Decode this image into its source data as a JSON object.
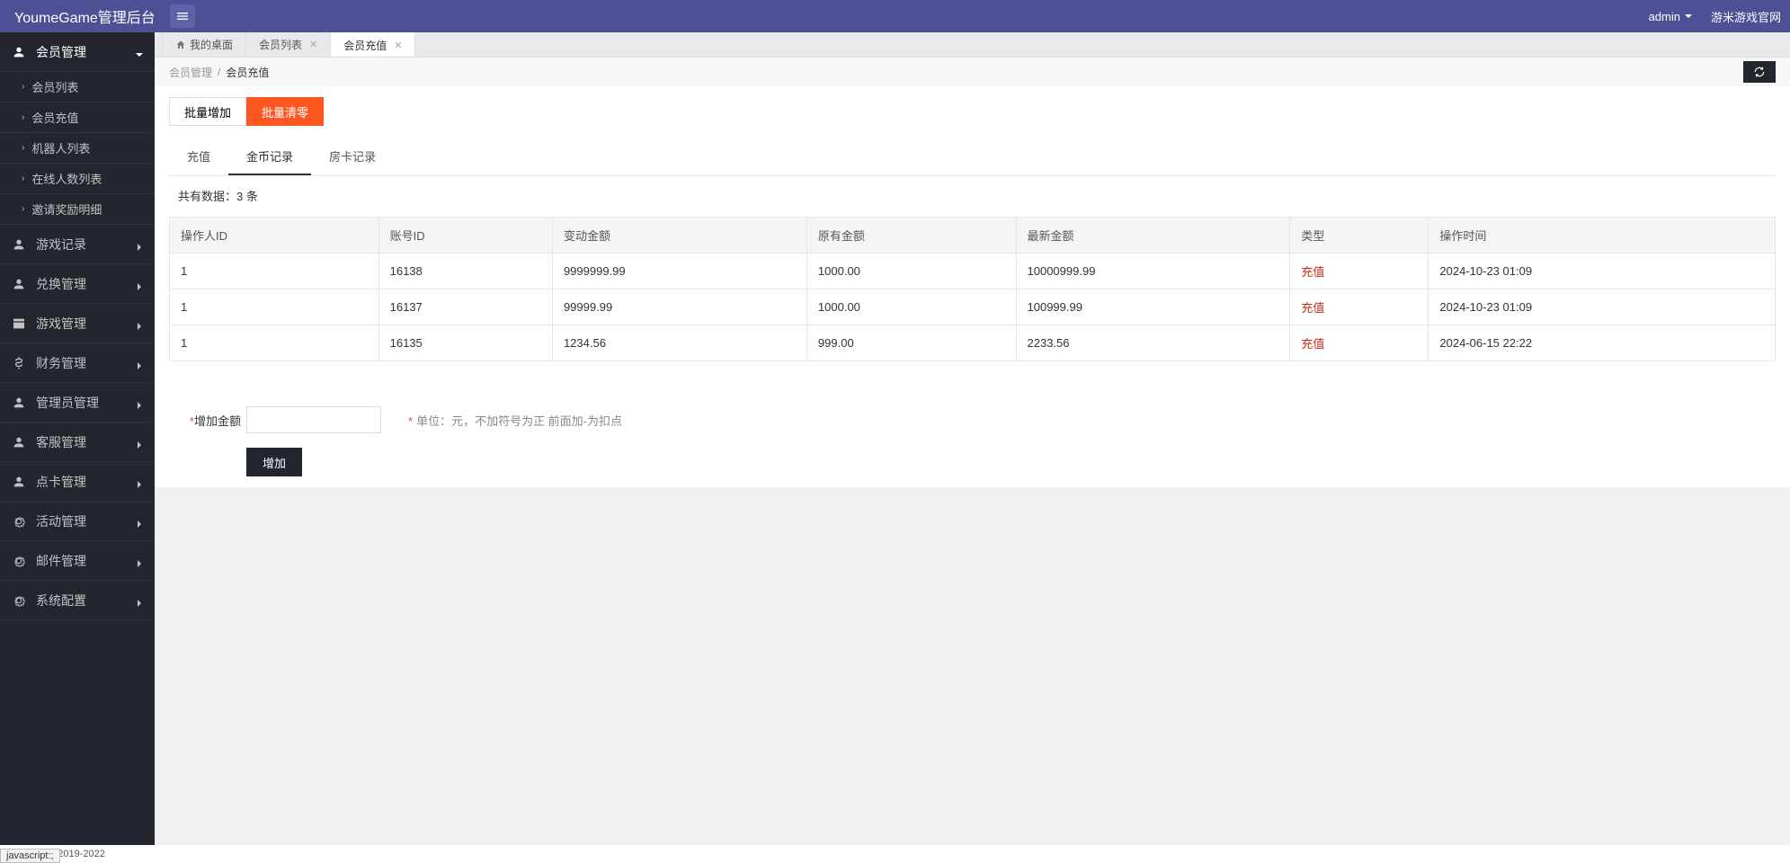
{
  "header": {
    "brand": "YoumeGame管理后台",
    "user": "admin",
    "site_link": "游米游戏官网"
  },
  "sidebar": {
    "items": [
      {
        "label": "会员管理",
        "icon": "user",
        "expanded": true,
        "children": [
          {
            "label": "会员列表"
          },
          {
            "label": "会员充值"
          },
          {
            "label": "机器人列表"
          },
          {
            "label": "在线人数列表"
          },
          {
            "label": "邀请奖励明细"
          }
        ]
      },
      {
        "label": "游戏记录",
        "icon": "user"
      },
      {
        "label": "兑换管理",
        "icon": "user"
      },
      {
        "label": "游戏管理",
        "icon": "browser"
      },
      {
        "label": "财务管理",
        "icon": "dollar"
      },
      {
        "label": "管理员管理",
        "icon": "user"
      },
      {
        "label": "客服管理",
        "icon": "user"
      },
      {
        "label": "点卡管理",
        "icon": "user"
      },
      {
        "label": "活动管理",
        "icon": "gear"
      },
      {
        "label": "邮件管理",
        "icon": "gear"
      },
      {
        "label": "系统配置",
        "icon": "gear"
      }
    ]
  },
  "tabs": [
    {
      "label": "我的桌面",
      "home": true,
      "closable": false
    },
    {
      "label": "会员列表",
      "closable": true
    },
    {
      "label": "会员充值",
      "closable": true,
      "active": true
    }
  ],
  "breadcrumb": {
    "parent": "会员管理",
    "current": "会员充值"
  },
  "actions": {
    "batch_add": "批量增加",
    "batch_clear": "批量清零"
  },
  "subtabs": [
    {
      "label": "充值"
    },
    {
      "label": "金币记录",
      "active": true
    },
    {
      "label": "房卡记录"
    }
  ],
  "summary_prefix": "共有数据：",
  "summary_count": "3 条",
  "table": {
    "columns": [
      "操作人ID",
      "账号ID",
      "变动金额",
      "原有金额",
      "最新金额",
      "类型",
      "操作时间"
    ],
    "rows": [
      {
        "operator": "1",
        "account": "16138",
        "delta": "9999999.99",
        "before": "1000.00",
        "after": "10000999.99",
        "type": "充值",
        "time": "2024-10-23 01:09"
      },
      {
        "operator": "1",
        "account": "16137",
        "delta": "99999.99",
        "before": "1000.00",
        "after": "100999.99",
        "type": "充值",
        "time": "2024-10-23 01:09"
      },
      {
        "operator": "1",
        "account": "16135",
        "delta": "1234.56",
        "before": "999.00",
        "after": "2233.56",
        "type": "充值",
        "time": "2024-06-15 22:22"
      }
    ]
  },
  "form": {
    "amount_label": "增加金额",
    "amount_value": "",
    "hint": "单位：元，不加符号为正 前面加-为扣点",
    "submit": "增加"
  },
  "footer": {
    "copyright": "Copyright ©2019-2022"
  },
  "status": "javascript:;"
}
